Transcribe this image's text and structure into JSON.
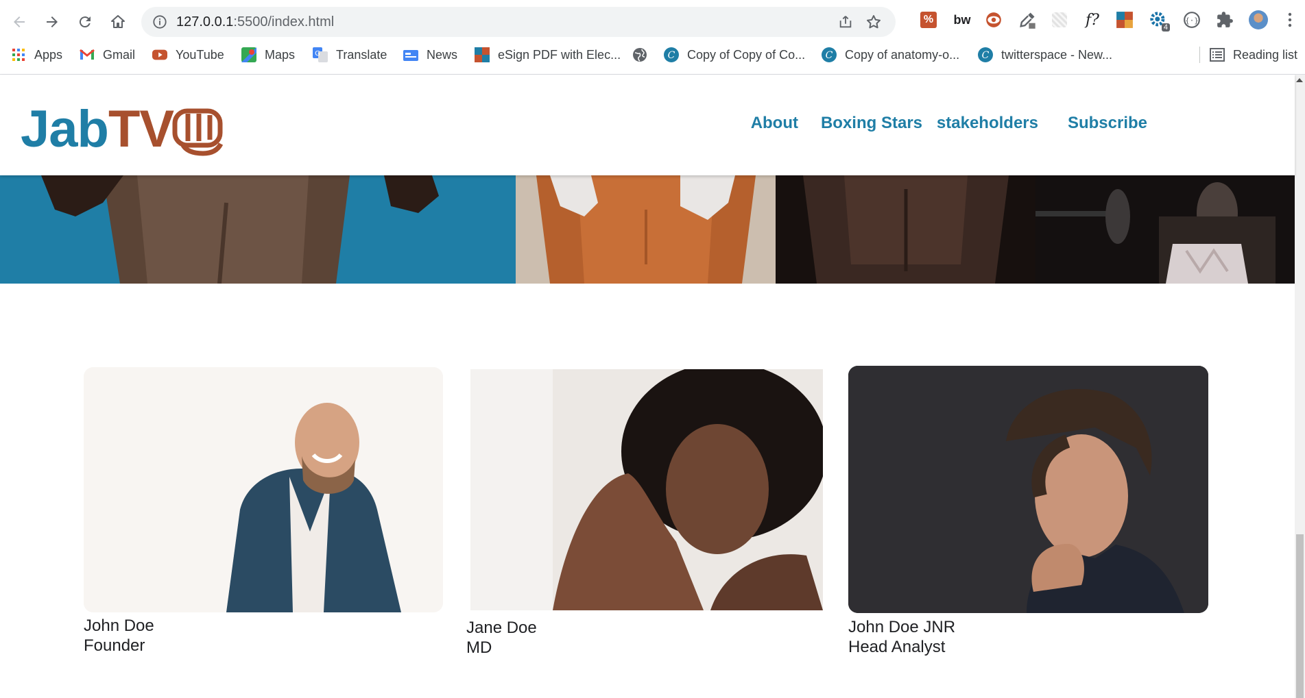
{
  "browser": {
    "url_host": "127.0.0.1",
    "url_path": ":5500/index.html",
    "extension_badge": "4",
    "bookmarks": [
      {
        "label": "Apps",
        "icon": "apps-grid-icon"
      },
      {
        "label": "Gmail",
        "icon": "gmail-icon"
      },
      {
        "label": "YouTube",
        "icon": "youtube-icon"
      },
      {
        "label": "Maps",
        "icon": "maps-icon"
      },
      {
        "label": "Translate",
        "icon": "translate-icon"
      },
      {
        "label": "News",
        "icon": "news-icon"
      },
      {
        "label": "eSign PDF with Elec...",
        "icon": "esign-icon"
      },
      {
        "label": "",
        "icon": "globe-icon"
      },
      {
        "label": "Copy of Copy of Co...",
        "icon": "canva-icon"
      },
      {
        "label": "Copy of anatomy-o...",
        "icon": "canva-icon"
      },
      {
        "label": "twitterspace - New...",
        "icon": "canva-icon"
      }
    ],
    "reading_list": "Reading list"
  },
  "site": {
    "logo_part1": "Jab",
    "logo_part2": "TV",
    "nav": [
      "About",
      "Boxing Stars",
      "stakeholders",
      "Subscribe"
    ]
  },
  "team": [
    {
      "name": "John Doe",
      "role": "Founder"
    },
    {
      "name": "Jane Doe",
      "role": "MD"
    },
    {
      "name": "John Doe JNR",
      "role": "Head Analyst"
    }
  ],
  "colors": {
    "brand_blue": "#1f7ea6",
    "brand_rust": "#a7502e"
  }
}
